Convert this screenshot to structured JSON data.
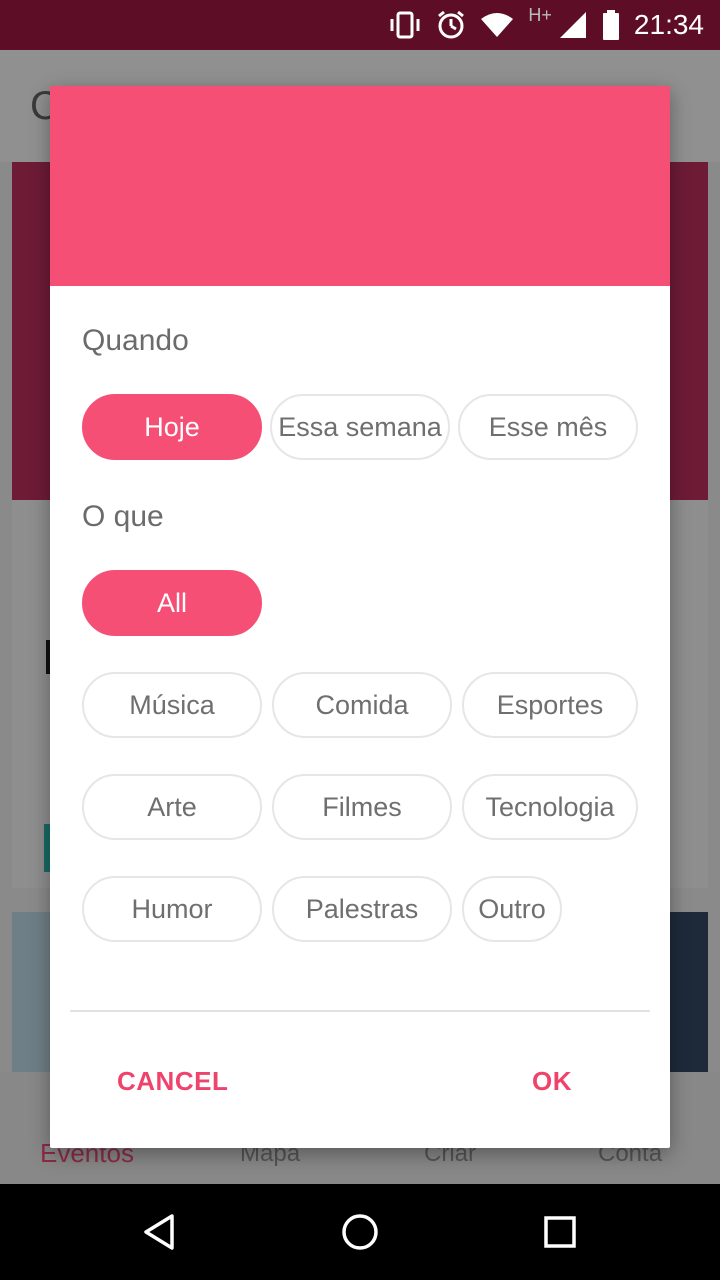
{
  "status_bar": {
    "time": "21:34",
    "network_label": "H+",
    "icons": [
      "vibrate-icon",
      "alarm-icon",
      "wifi-icon",
      "signal-icon",
      "battery-icon"
    ]
  },
  "background_app": {
    "appbar_title_partial": "C",
    "bottom_nav": [
      {
        "label": "Eventos",
        "active": true
      },
      {
        "label": "Mapa",
        "active": false
      },
      {
        "label": "Criar",
        "active": false
      },
      {
        "label": "Conta",
        "active": false
      }
    ]
  },
  "dialog": {
    "header_color": "#f64f76",
    "when": {
      "label": "Quando",
      "options": [
        {
          "label": "Hoje",
          "selected": true
        },
        {
          "label": "Essa semana",
          "selected": false
        },
        {
          "label": "Esse mês",
          "selected": false
        }
      ]
    },
    "what": {
      "label": "O que",
      "all_option": {
        "label": "All",
        "selected": true
      },
      "categories": [
        {
          "label": "Música"
        },
        {
          "label": "Comida"
        },
        {
          "label": "Esportes"
        },
        {
          "label": "Arte"
        },
        {
          "label": "Filmes"
        },
        {
          "label": "Tecnologia"
        },
        {
          "label": "Humor"
        },
        {
          "label": "Palestras"
        },
        {
          "label": "Outro"
        }
      ]
    },
    "actions": {
      "cancel": "CANCEL",
      "ok": "OK"
    }
  },
  "accent_color": "#f64f76",
  "system_nav": {
    "icons": [
      "back-icon",
      "home-icon",
      "recents-icon"
    ]
  }
}
